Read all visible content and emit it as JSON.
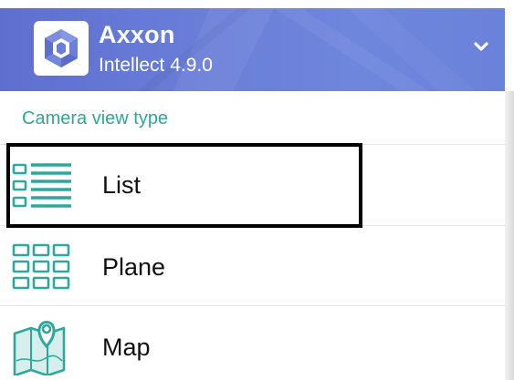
{
  "header": {
    "brand_name": "Axxon",
    "brand_version": "Intellect 4.9.0",
    "logo_icon": "axxon-logo-icon",
    "toggle_icon": "chevron-down-icon"
  },
  "section": {
    "title": "Camera view type"
  },
  "view_types": [
    {
      "label": "List",
      "icon": "list-view-icon",
      "selected": true
    },
    {
      "label": "Plane",
      "icon": "grid-view-icon",
      "selected": false
    },
    {
      "label": "Map",
      "icon": "map-view-icon",
      "selected": false
    }
  ],
  "colors": {
    "header": "#6a7ed8",
    "accent": "#2fa79a",
    "highlight_border": "#000000"
  }
}
